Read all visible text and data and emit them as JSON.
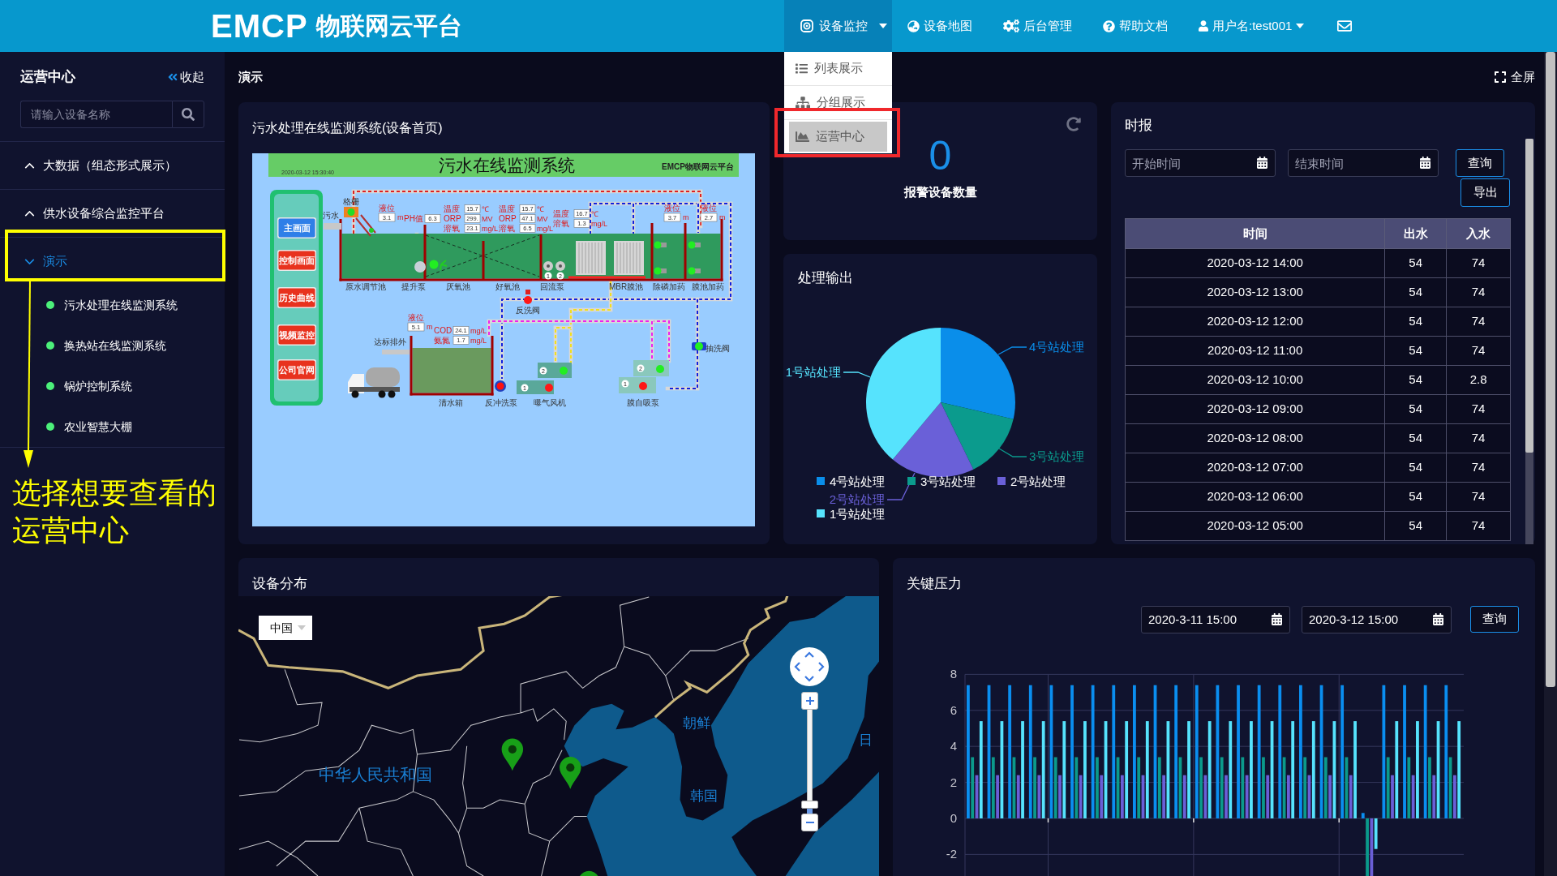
{
  "header": {
    "logo_mark": "EMCP",
    "logo_text": "物联网云平台",
    "nav": [
      {
        "kind": "monitor",
        "label": "设备监控",
        "selected": true,
        "dropdown": true,
        "menu": [
          {
            "kind": "list",
            "label": "列表展示",
            "selected": false
          },
          {
            "kind": "group",
            "label": "分组展示",
            "selected": false
          },
          {
            "kind": "chart",
            "label": "运营中心",
            "selected": true
          }
        ]
      },
      {
        "kind": "map",
        "label": "设备地图",
        "selected": false
      },
      {
        "kind": "admin",
        "label": "后台管理",
        "selected": false
      },
      {
        "kind": "help",
        "label": "帮助文档",
        "selected": false
      },
      {
        "kind": "user",
        "label": "用户名:test001",
        "selected": false,
        "dropdown": true
      }
    ]
  },
  "sidebar": {
    "title": "运营中心",
    "collapse": "收起",
    "search": {
      "placeholder": "请输入设备名称"
    },
    "groups": [
      {
        "label": "大数据（组态形式展示）",
        "expanded": false,
        "selected": false
      },
      {
        "label": "供水设备综合监控平台",
        "expanded": false,
        "selected": false
      },
      {
        "label": "演示",
        "expanded": true,
        "selected": true,
        "children": [
          {
            "label": "污水处理在线监测系统",
            "color": "#4cf07a"
          },
          {
            "label": "换热站在线监测系统",
            "color": "#4cf07a"
          },
          {
            "label": "锅炉控制系统",
            "color": "#4cf07a"
          },
          {
            "label": "农业智慧大棚",
            "color": "#4cf07a"
          }
        ]
      }
    ]
  },
  "annotation": {
    "text": "选择想要查看的运营中心"
  },
  "breadcrumb": "演示",
  "fullscreen": "全屏",
  "device_home": {
    "title": "污水处理在线监测系统(设备首页)",
    "diagram": {
      "title": "污水在线监测系统",
      "timestamp": "2020-03-12 15:30:40",
      "brand": "EMCP物联网云平台",
      "menu": [
        {
          "label": "主画面",
          "kind": "primary"
        },
        {
          "label": "控制画面",
          "kind": "danger"
        },
        {
          "label": "历史曲线",
          "kind": "danger"
        },
        {
          "label": "视频监控",
          "kind": "danger"
        },
        {
          "label": "公司官网",
          "kind": "danger"
        }
      ],
      "labels": [
        "污水",
        "格栅",
        "原水调节池",
        "提升泵",
        "厌氧池",
        "好氧池",
        "回流泵",
        "MBR膜池",
        "除磷加药",
        "膜池加药",
        "反洗阀",
        "达标排外",
        "清水箱",
        "反冲洗泵",
        "曝气风机",
        "膜自吸泵",
        "抽洗阀"
      ],
      "gauges": [
        {
          "rows": [
            {
              "label": "液位",
              "value": "3.1",
              "unit": "m"
            }
          ]
        },
        {
          "rows": [
            {
              "label": "PH值",
              "value": "6.3"
            }
          ]
        },
        {
          "rows": [
            {
              "label": "温度",
              "value": "15.7",
              "unit": "℃"
            },
            {
              "label": "ORP",
              "value": "299.",
              "unit": "MV"
            },
            {
              "label": "溶氧",
              "value": "23.1",
              "unit": "mg/L"
            }
          ]
        },
        {
          "rows": [
            {
              "label": "温度",
              "value": "15.7",
              "unit": "℃"
            },
            {
              "label": "ORP",
              "value": "47.1",
              "unit": "MV"
            },
            {
              "label": "溶氧",
              "value": "6.5",
              "unit": "mg/L"
            }
          ]
        },
        {
          "rows": [
            {
              "label": "温度",
              "value": "16.7",
              "unit": "℃"
            },
            {
              "label": "溶氧",
              "value": "1.3",
              "unit": "mg/L"
            }
          ]
        },
        {
          "rows": [
            {
              "label": "液位",
              "value": "3.7",
              "unit": "m"
            }
          ]
        },
        {
          "rows": [
            {
              "label": "液位",
              "value": "2.7",
              "unit": "m"
            }
          ]
        },
        {
          "rows": [
            {
              "label": "液位",
              "value": "5.1",
              "unit": "m"
            }
          ]
        },
        {
          "rows": [
            {
              "label": "COD",
              "value": "24.1",
              "unit": "mg/L"
            },
            {
              "label": "氨氮",
              "value": "1.7",
              "unit": "mg/L"
            }
          ]
        }
      ],
      "pump_numbers": [
        "1",
        "2",
        "2",
        "1",
        "2",
        "1"
      ]
    }
  },
  "alarm": {
    "value": "0",
    "label": "报警设备数量"
  },
  "output": {
    "title": "处理输出",
    "slices": [
      {
        "label": "4号站处理",
        "color": "#0a8eea"
      },
      {
        "label": "3号站处理",
        "color": "#0b9b8d"
      },
      {
        "label": "2号站处理",
        "color": "#6a60d8"
      },
      {
        "label": "1号站处理",
        "color": "#56e3fd"
      }
    ],
    "legend": [
      {
        "label": "4号站处理",
        "color": "#0a8eea"
      },
      {
        "label": "3号站处理",
        "color": "#0b9b8d"
      },
      {
        "label": "2号站处理",
        "color": "#6a60d8"
      },
      {
        "label": "1号站处理",
        "color": "#56e3fd"
      }
    ]
  },
  "hourly": {
    "title": "时报",
    "start": {
      "placeholder": "开始时间"
    },
    "end": {
      "placeholder": "结束时间"
    },
    "buttons": [
      "查询",
      "导出"
    ],
    "columns": [
      "时间",
      "出水",
      "入水"
    ],
    "rows": [
      [
        "2020-03-12 14:00",
        "54",
        "74"
      ],
      [
        "2020-03-12 13:00",
        "54",
        "74"
      ],
      [
        "2020-03-12 12:00",
        "54",
        "74"
      ],
      [
        "2020-03-12 11:00",
        "54",
        "74"
      ],
      [
        "2020-03-12 10:00",
        "54",
        "2.8"
      ],
      [
        "2020-03-12 09:00",
        "54",
        "74"
      ],
      [
        "2020-03-12 08:00",
        "54",
        "74"
      ],
      [
        "2020-03-12 07:00",
        "54",
        "74"
      ],
      [
        "2020-03-12 06:00",
        "54",
        "74"
      ],
      [
        "2020-03-12 05:00",
        "54",
        "74"
      ]
    ]
  },
  "map": {
    "title": "设备分布",
    "region": "中国",
    "labels": [
      "中华人民共和国",
      "朝鲜",
      "韩国",
      "日"
    ],
    "zoom": {
      "level": 0.05
    }
  },
  "pressure": {
    "title": "关键压力",
    "from": "2020-3-11 15:00",
    "to": "2020-3-12 15:00",
    "button": "查询",
    "chart_data": {
      "type": "bar",
      "grid": true,
      "yticks": [
        {
          "value": 8,
          "label": "8"
        },
        {
          "value": 6,
          "label": "6"
        },
        {
          "value": 4,
          "label": "4"
        },
        {
          "value": 2,
          "label": "2"
        },
        {
          "value": 0,
          "label": "0"
        },
        {
          "value": -2,
          "label": "-2"
        }
      ],
      "ylim": [
        -3.2,
        8
      ],
      "series": [
        {
          "color": "#0a8ef0",
          "values": [
            7.4,
            7.4,
            7.4,
            7.4,
            7.4,
            7.4,
            7.4,
            7.4,
            7.4,
            7.4,
            7.4,
            7.4,
            7.4,
            7.4,
            7.4,
            7.4,
            7.4,
            7.4,
            7.4,
            0.3,
            7.4,
            7.4,
            7.4,
            7.4
          ]
        },
        {
          "color": "#0b9a8b",
          "values": [
            3.4,
            3.4,
            3.4,
            3.4,
            3.4,
            3.4,
            3.4,
            3.4,
            3.4,
            3.4,
            3.4,
            3.4,
            3.4,
            3.4,
            3.4,
            3.4,
            3.4,
            3.4,
            3.4,
            -3.2,
            3.4,
            3.4,
            3.4,
            3.4
          ]
        },
        {
          "color": "#6a5fd6",
          "values": [
            2.4,
            2.4,
            2.4,
            2.4,
            2.4,
            2.4,
            2.4,
            2.4,
            2.4,
            2.4,
            2.4,
            2.4,
            2.4,
            2.4,
            2.4,
            2.4,
            2.4,
            2.4,
            2.4,
            -3.2,
            2.4,
            2.4,
            2.4,
            2.4
          ]
        },
        {
          "color": "#56e3fd",
          "values": [
            5.4,
            5.4,
            5.4,
            5.4,
            5.4,
            5.4,
            5.4,
            5.4,
            5.4,
            5.4,
            5.4,
            5.4,
            5.4,
            5.4,
            5.4,
            5.4,
            5.4,
            5.4,
            5.4,
            -1.7,
            5.4,
            5.4,
            5.4,
            5.4
          ]
        }
      ]
    }
  }
}
